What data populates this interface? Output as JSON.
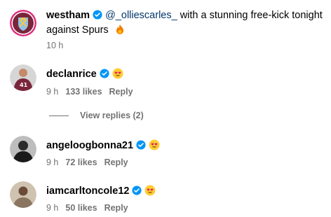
{
  "post": {
    "username": "westham",
    "mention": "@_olliescarles_",
    "caption_rest": " with a stunning free-kick tonight against Spurs",
    "time": "10 h"
  },
  "comments": [
    {
      "username": "declanrice",
      "emoji": "heart-eyes",
      "time": "9 h",
      "likes": "133 likes",
      "reply": "Reply"
    },
    {
      "username": "angeloogbonna21",
      "emoji": "heart-eyes",
      "time": "9 h",
      "likes": "72 likes",
      "reply": "Reply"
    },
    {
      "username": "iamcarltoncole12",
      "emoji": "heart-eyes",
      "time": "9 h",
      "likes": "50 likes",
      "reply": "Reply"
    }
  ],
  "view_replies": "View replies (2)",
  "colors": {
    "verified": "#0095f6",
    "meta": "#737373",
    "mention": "#00376b",
    "west_ham_claret": "#7a263a"
  }
}
